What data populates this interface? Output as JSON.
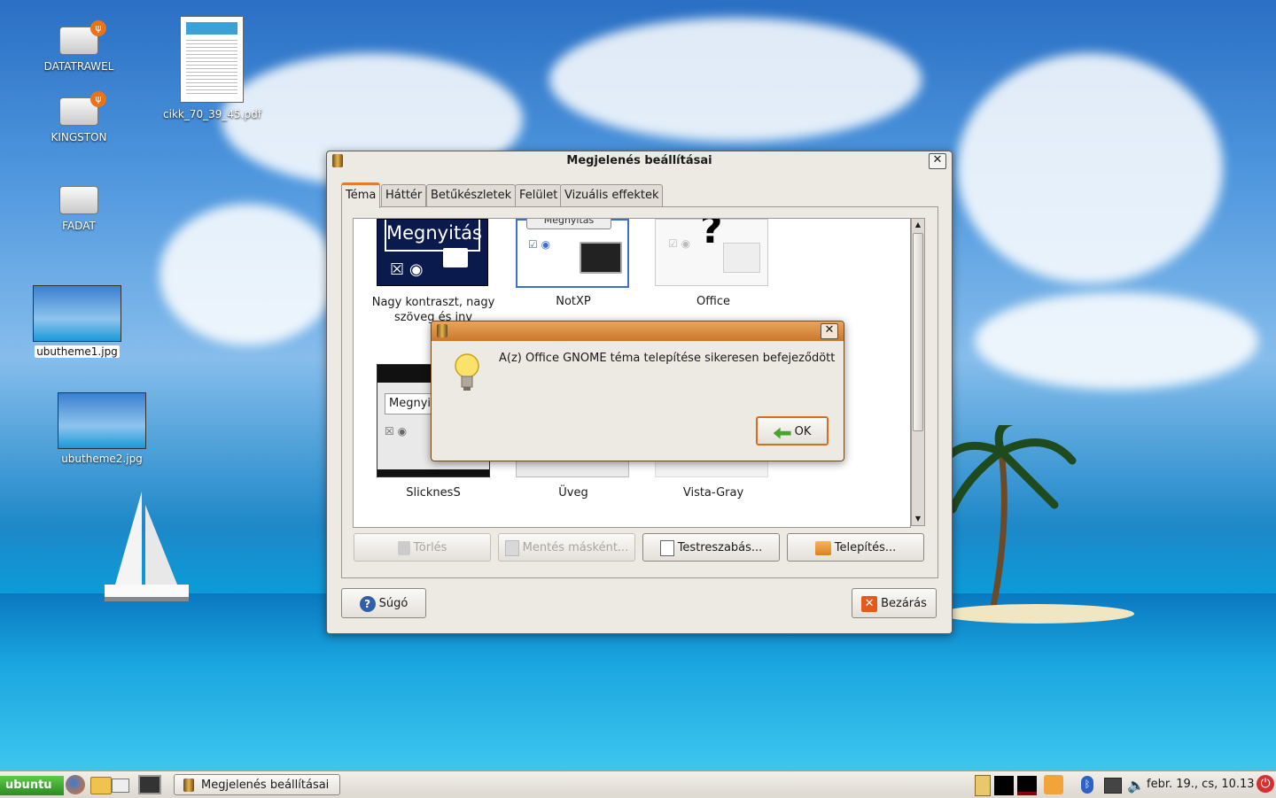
{
  "desktop_icons": [
    {
      "label": "DATATRAWEL"
    },
    {
      "label": "KINGSTON"
    },
    {
      "label": "FADAT"
    },
    {
      "label": "cikk_70_39_45.pdf"
    },
    {
      "label": "ubutheme1.jpg"
    },
    {
      "label": "ubutheme2.jpg"
    }
  ],
  "main_window": {
    "title": "Megjelenés beállításai",
    "tabs": [
      {
        "label": "Téma"
      },
      {
        "label": "Háttér"
      },
      {
        "label": "Betűkészletek"
      },
      {
        "label": "Felület"
      },
      {
        "label": "Vizuális effektek"
      }
    ],
    "themes": [
      {
        "name": "Nagy kontraszt, nagy szöveg és inv",
        "preview_text": "Megnyitás"
      },
      {
        "name": "NotXP",
        "preview_text": "Megnyitás"
      },
      {
        "name": "Office"
      },
      {
        "name": "SlicknesS",
        "preview_text": "Megnyit"
      },
      {
        "name": "Üveg"
      },
      {
        "name": "Vista-Gray"
      }
    ],
    "buttons": {
      "delete": "Törlés",
      "save_as": "Mentés másként...",
      "customize": "Testreszabás...",
      "install": "Telepítés...",
      "help": "Súgó",
      "close": "Bezárás"
    }
  },
  "dialog": {
    "message": "A(z) Office GNOME téma telepítése sikeresen befejeződött",
    "ok": "OK"
  },
  "taskbar": {
    "menu_label": "ubuntu",
    "task": "Megjelenés beállításai",
    "clock": "febr. 19., cs, 10.13"
  },
  "colors": {
    "accent": "#e07c2e",
    "dialog_title": "#d9904a"
  }
}
